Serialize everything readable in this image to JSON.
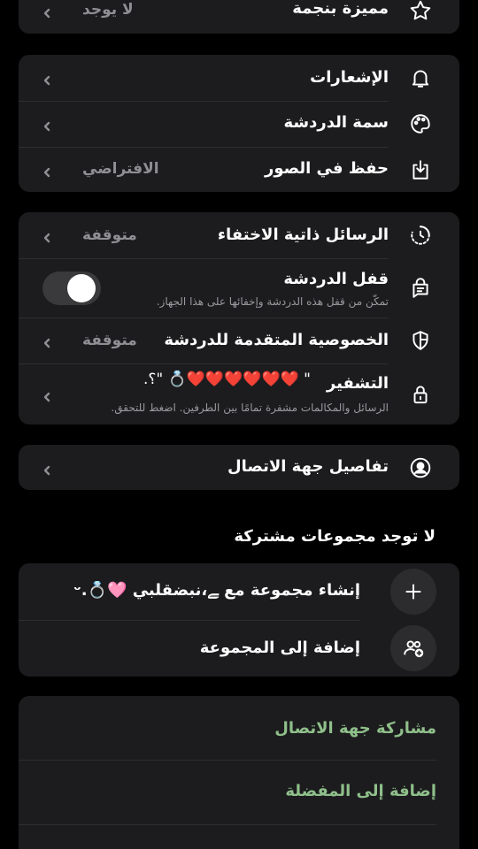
{
  "star_row": {
    "title": "مميزة بنجمة",
    "value": "لا يوجد"
  },
  "group1": {
    "notifications": {
      "title": "الإشعارات"
    },
    "theme": {
      "title": "سمة الدردشة"
    },
    "save_photos": {
      "title": "حفظ في الصور",
      "value": "الافتراضي"
    }
  },
  "group2": {
    "disappearing": {
      "title": "الرسائل ذاتية الاختفاء",
      "value": "متوقفة"
    },
    "chat_lock": {
      "title": "قفل الدردشة",
      "subtitle": "تمكّن من قفل هذه الدردشة وإخفائها على هذا الجهاز.",
      "enabled": false
    },
    "advanced_privacy": {
      "title": "الخصوصية المتقدمة للدردشة",
      "value": "متوقفة"
    },
    "encryption": {
      "title": "التشفير",
      "name_tag": "\" ❤️❤️❤️❤️❤️❤️💍 \"؟.",
      "subtitle": "الرسائل والمكالمات مشفرة تمامًا بين الطرفين. اضغط للتحقق."
    }
  },
  "contact_details": {
    "title": "تفاصيل جهة الاتصال"
  },
  "groups": {
    "heading": "لا توجد مجموعات مشتركة",
    "create": {
      "title": "إنشاء مجموعة مع ﮯ،نبضقلبي 🩷💍.ᵕ"
    },
    "add": {
      "title": "إضافة إلى المجموعة"
    }
  },
  "actions": {
    "share": "مشاركة جهة الاتصال",
    "favorite": "إضافة إلى المفضلة"
  }
}
